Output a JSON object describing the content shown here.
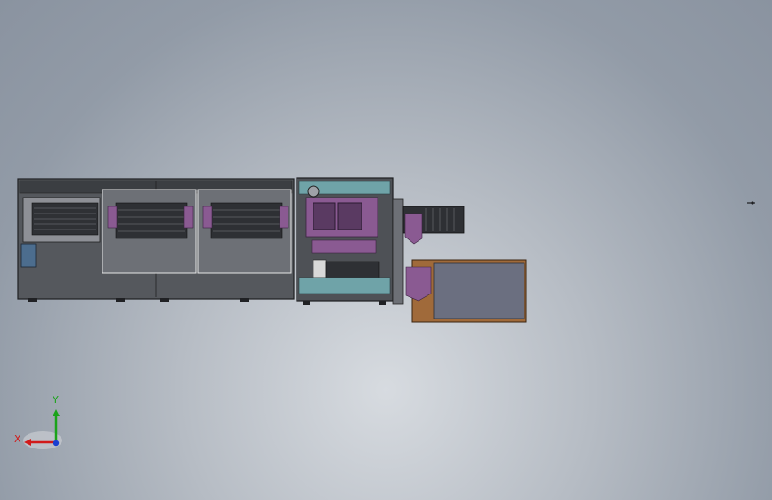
{
  "triad": {
    "x_label": "X",
    "y_label": "Y",
    "x_color": "#d11a1a",
    "y_color": "#1aa31a",
    "z_color": "#1a3fd1"
  },
  "model": {
    "frame_color": "#4a4d52",
    "panel_color": "#5c6066",
    "accent_purple": "#8a5a92",
    "accent_teal": "#6fa3a8",
    "conveyor_color": "#2e3034",
    "tray_color": "#a06a3a",
    "tray_inner": "#6b6f80"
  }
}
